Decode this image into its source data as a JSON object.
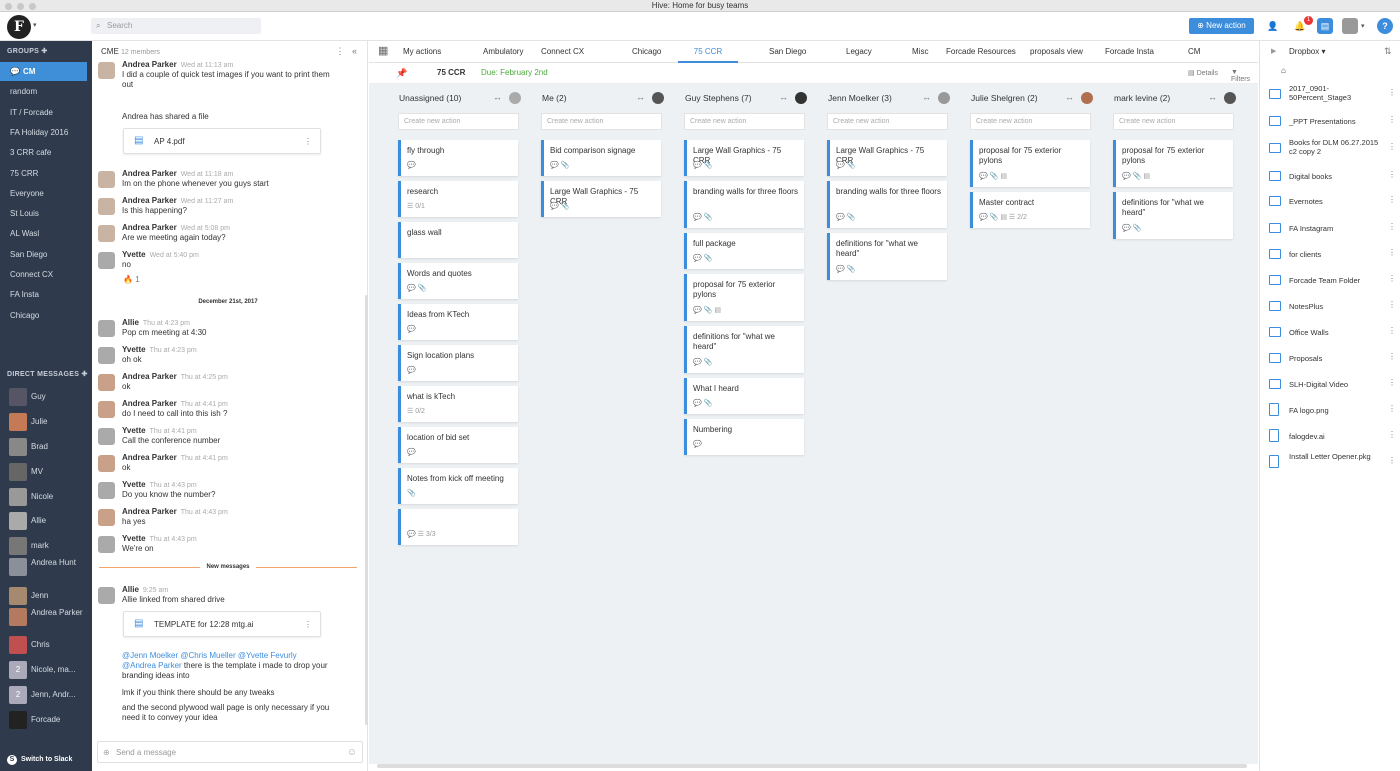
{
  "window": {
    "title": "Hive: Home for busy teams"
  },
  "topbar": {
    "logo": "F",
    "search_placeholder": "Search",
    "new_action": "New action",
    "notifications_count": "1",
    "help": "?"
  },
  "sidebar": {
    "groups_label": "GROUPS",
    "groups": [
      "CM",
      "random",
      "IT / Forcade",
      "FA Holiday 2016",
      "3 CRR cafe",
      "75 CRR",
      "Everyone",
      "St Louis",
      "AL Wasl",
      "San Diego",
      "Connect CX",
      "FA Insta",
      "Chicago"
    ],
    "dm_label": "DIRECT MESSAGES",
    "dms": [
      "Guy",
      "Julie",
      "Brad",
      "MV",
      "Nicole",
      "Allie",
      "mark",
      "Andrea Hunt",
      "Jenn",
      "Andrea Parker",
      "Chris",
      "Nicole, ma...",
      "Jenn, Andr...",
      "Forcade"
    ],
    "dm_avatar_text": {
      "nicole_group": "2",
      "jenn_group": "2"
    },
    "switch_label": "Switch to Slack"
  },
  "chat": {
    "channel": "CME",
    "members": "12 members",
    "messages": [
      {
        "name": "Andrea Parker",
        "time": "Wed at 11:13 am",
        "text": "I did a couple of quick test images if you want to print them out"
      },
      {
        "name": "",
        "time": "",
        "text": "Andrea has shared a file"
      },
      {
        "name": "Andrea Parker",
        "time": "Wed at 11:18 am",
        "text": "Im on the phone whenever you guys start"
      },
      {
        "name": "Andrea Parker",
        "time": "Wed at 11:27 am",
        "text": "Is this happening?"
      },
      {
        "name": "Andrea Parker",
        "time": "Wed at 5:08 pm",
        "text": "Are we meeting again today?"
      },
      {
        "name": "Yvette",
        "time": "Wed at 5:40 pm",
        "text": "no"
      },
      {
        "name": "Allie",
        "time": "Thu at 4:23 pm",
        "text": "Pop cm   meeting at 4:30"
      },
      {
        "name": "Yvette",
        "time": "Thu at 4:23 pm",
        "text": "oh ok"
      },
      {
        "name": "Andrea Parker",
        "time": "Thu at 4:25 pm",
        "text": "ok"
      },
      {
        "name": "Andrea Parker",
        "time": "Thu at 4:41 pm",
        "text": "do I need to call into this ish ?"
      },
      {
        "name": "Yvette",
        "time": "Thu at 4:41 pm",
        "text": "Call the conference number"
      },
      {
        "name": "Andrea Parker",
        "time": "Thu at 4:41 pm",
        "text": "ok"
      },
      {
        "name": "Yvette",
        "time": "Thu at 4:43 pm",
        "text": "Do you know the number?"
      },
      {
        "name": "Andrea Parker",
        "time": "Thu at 4:43 pm",
        "text": "ha yes"
      },
      {
        "name": "Yvette",
        "time": "Thu at 4:43 pm",
        "text": "We're on"
      },
      {
        "name": "Allie",
        "time": "9:25 am",
        "text": "Allie linked from shared drive"
      }
    ],
    "file1": "AP 4.pdf",
    "file2": "TEMPLATE for 12:28 mtg.ai",
    "reaction": "1",
    "date_divider": "December 21st, 2017",
    "new_divider": "New messages",
    "mentions": "@Jenn Moelker @Chris Mueller @Yvette Fevurly",
    "mention_andrea": "@Andrea Parker",
    "mention_rest": " there is the template i made to drop your branding ideas into",
    "text2": "lmk if you think there should be any tweaks",
    "text3": "and the second plywood wall page is only necessary if you need it to convey your idea",
    "input_placeholder": "Send a message"
  },
  "board": {
    "tabs": [
      "My actions",
      "Ambulatory",
      "Connect CX",
      "Chicago",
      "75 CCR",
      "San Diego",
      "Legacy",
      "Misc",
      "Forcade Resources",
      "proposals view",
      "Forcade Insta",
      "CM"
    ],
    "project": "75 CCR",
    "due": "Due: February 2nd",
    "details": "Details",
    "filters": "Filters",
    "create_placeholder": "Create new action",
    "columns": [
      {
        "title": "Unassigned (10)",
        "cards": [
          {
            "text": "fly through",
            "meta": "💬"
          },
          {
            "text": "research",
            "meta": "☰ 0/1"
          },
          {
            "text": "glass wall",
            "meta": ""
          },
          {
            "text": "Words and quotes",
            "meta": "💬  📎"
          },
          {
            "text": "Ideas from KTech",
            "meta": "💬"
          },
          {
            "text": "Sign location plans",
            "meta": "💬"
          },
          {
            "text": "what is kTech",
            "meta": "☰ 0/2"
          },
          {
            "text": "location of bid set",
            "meta": "💬"
          },
          {
            "text": "Notes from kick off meeting",
            "meta": "📎"
          },
          {
            "text": "",
            "meta": "💬  ☰ 3/3"
          }
        ]
      },
      {
        "title": "Me (2)",
        "cards": [
          {
            "text": "Bid comparison signage",
            "meta": "💬  📎"
          },
          {
            "text": "Large Wall Graphics - 75 CRR",
            "meta": "💬  📎"
          }
        ]
      },
      {
        "title": "Guy Stephens (7)",
        "cards": [
          {
            "text": "Large Wall Graphics - 75 CRR",
            "meta": "💬  📎"
          },
          {
            "text": "branding walls for three floors",
            "meta": "💬  📎"
          },
          {
            "text": "full package",
            "meta": "💬  📎"
          },
          {
            "text": "proposal for 75 exterior pylons",
            "meta": "💬  📎  ▤"
          },
          {
            "text": "definitions for \"what we heard\"",
            "meta": "💬  📎"
          },
          {
            "text": "What I heard",
            "meta": "💬  📎"
          },
          {
            "text": "Numbering",
            "meta": "💬"
          }
        ]
      },
      {
        "title": "Jenn Moelker (3)",
        "cards": [
          {
            "text": "Large Wall Graphics - 75 CRR",
            "meta": "💬  📎"
          },
          {
            "text": "branding walls for three floors",
            "meta": "💬  📎"
          },
          {
            "text": "definitions for \"what we heard\"",
            "meta": "💬  📎"
          }
        ]
      },
      {
        "title": "Julie Shelgren (2)",
        "cards": [
          {
            "text": "proposal for 75 exterior pylons",
            "meta": "💬  📎  ▤"
          },
          {
            "text": "Master contract",
            "meta": "💬  📎  ▤  ☰ 2/2"
          }
        ]
      },
      {
        "title": "mark levine (2)",
        "cards": [
          {
            "text": "proposal for 75 exterior pylons",
            "meta": "💬  📎  ▤"
          },
          {
            "text": "definitions for \"what we heard\"",
            "meta": "💬  📎"
          }
        ]
      }
    ]
  },
  "drive": {
    "title": "Dropbox",
    "items": [
      "2017_0901-50Percent_Stage3",
      "_PPT Presentations",
      "Books for DLM 06.27.2015 c2 copy 2",
      "Digital books",
      "Evernotes",
      "FA Instagram",
      "for clients",
      "Forcade Team Folder",
      "NotesPlus",
      "Office Walls",
      "Proposals",
      "SLH-Digital Video",
      "FA logo.png",
      "falogdev.ai",
      "Install Letter Opener.pkg"
    ]
  },
  "colors": {
    "accent": "#3d8ddd",
    "sidebar": "#2f3b4d",
    "due": "#4caa3c",
    "new_divider": "#f2a46a"
  }
}
